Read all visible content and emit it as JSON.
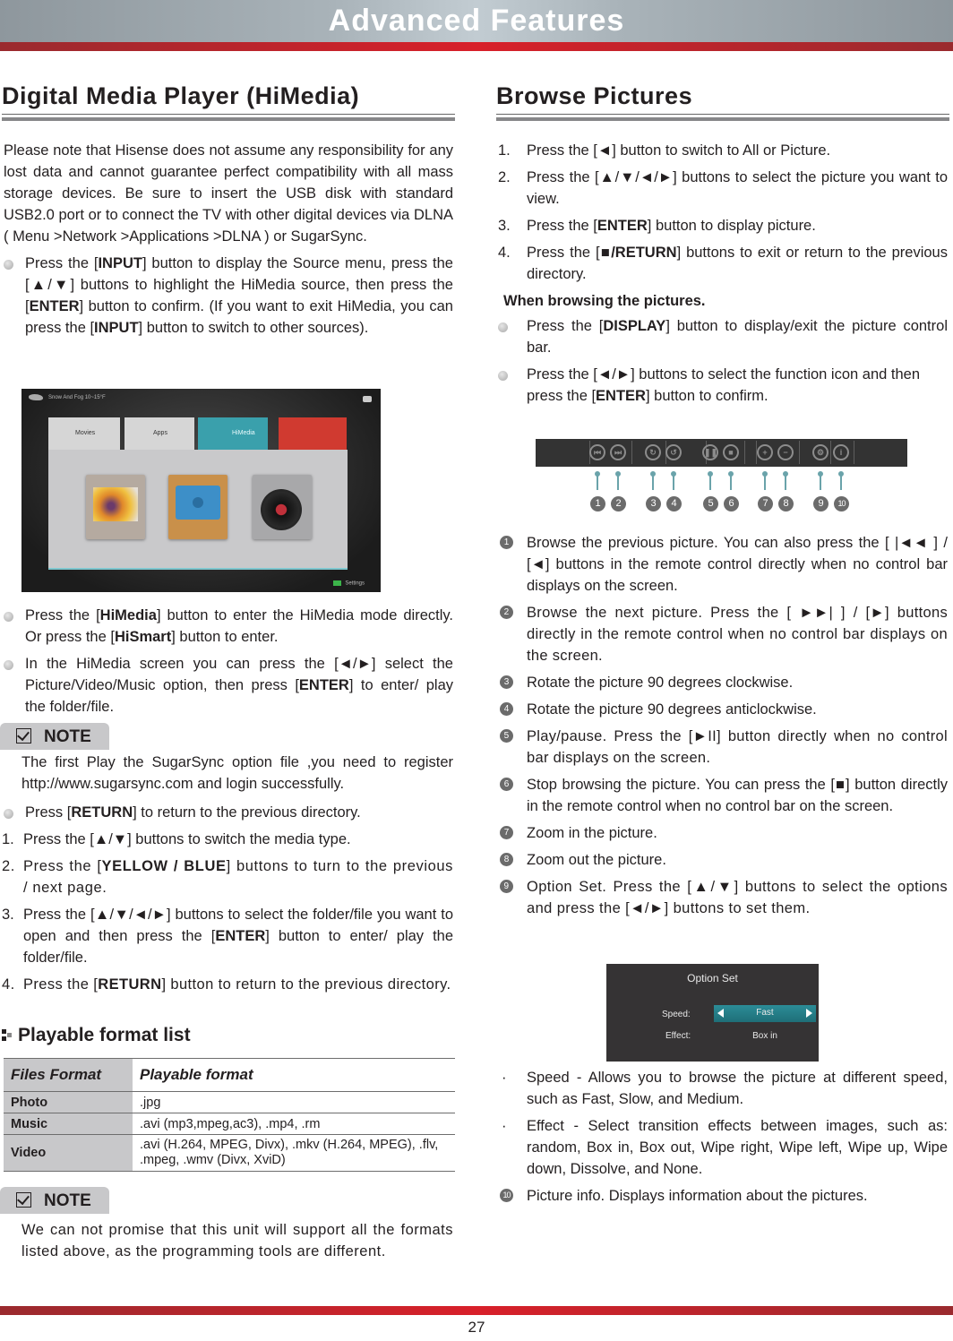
{
  "banner": {
    "title": "Advanced Features"
  },
  "left": {
    "title": "Digital Media Player (HiMedia)",
    "intro": "Please note that Hisense does not assume any responsibility for any lost data and cannot guarantee perfect compatibility with all mass storage devices. Be sure to insert the USB disk with standard USB2.0 port or to connect the TV with other digital devices via DLNA ( Menu >Network >Applications >DLNA ) or SugarSync.",
    "bullet1": {
      "t1": "Press the [",
      "b1": "INPUT",
      "t2": "] button to display the Source menu, press the [▲/▼] buttons to highlight the HiMedia source, then press the [",
      "b2": "ENTER",
      "t3": "] button to confirm. (If you want to exit HiMedia, you can press the [",
      "b3": "INPUT",
      "t4": "] button to switch to other sources)."
    },
    "tv_screen": {
      "top_text": "Snow And Fog  10~15°F",
      "tabs": [
        "Movies",
        "Apps",
        "HiMedia"
      ],
      "cards": [
        "Photo",
        "Video",
        "Music"
      ],
      "settings_label": "Settings"
    },
    "bullet2": {
      "t1": "Press the [",
      "b1": "HiMedia",
      "t2": "] button to enter the HiMedia mode directly. Or press the [",
      "b2": "HiSmart",
      "t3": "] button to enter."
    },
    "bullet3": {
      "t1": "In the HiMedia screen you can press the [◄/►] select the Picture/Video/Music option, then press [",
      "b1": "ENTER",
      "t2": "] to enter/ play the folder/file."
    },
    "note1": {
      "label": "NOTE",
      "text": "The first Play the SugarSync option file ,you need to register http://www.sugarsync.com and login successfully."
    },
    "bullet4": {
      "t1": "Press [",
      "b1": "RETURN",
      "t2": "] to return to the previous directory."
    },
    "steps": [
      {
        "n": "1.",
        "t1": "Press the [▲/▼] buttons to switch the media type.",
        "b1": "",
        "t2": ""
      },
      {
        "n": "2.",
        "t1": "Press the [",
        "b1": "YELLOW / BLUE",
        "t2": "] buttons to turn to the previous / next page."
      },
      {
        "n": "3.",
        "t1": "Press the [▲/▼/◄/►] buttons to select the folder/file you want to open and then press the [",
        "b1": "ENTER",
        "t2": "] button to enter/ play the folder/file."
      },
      {
        "n": "4.",
        "t1": "Press the [",
        "b1": "RETURN",
        "t2": "] button to return to the previous directory."
      }
    ],
    "formats": {
      "title": "Playable format list",
      "headers": [
        "Files Format",
        "Playable format"
      ],
      "rows": [
        {
          "type": "Photo",
          "format": ".jpg"
        },
        {
          "type": "Music",
          "format": ".avi (mp3,mpeg,ac3), .mp4, .rm"
        },
        {
          "type": "Video",
          "format": ".avi (H.264, MPEG, Divx), .mkv (H.264, MPEG), .flv, .mpeg, .wmv (Divx, XviD)"
        }
      ]
    },
    "note2": {
      "label": "NOTE",
      "text": "We can not promise that this unit will support all the formats listed above, as the programming tools are different."
    }
  },
  "right": {
    "title": "Browse Pictures",
    "steps": [
      {
        "n": "1.",
        "t1": "Press the [◄] button to switch to All or Picture.",
        "b1": "",
        "t2": ""
      },
      {
        "n": "2.",
        "t1": "Press the [▲/▼/◄/►] buttons to select the picture you want to view.",
        "b1": "",
        "t2": ""
      },
      {
        "n": "3.",
        "t1": "Press the [",
        "b1": "ENTER",
        "t2": "] button to display picture."
      },
      {
        "n": "4.",
        "t1": "Press the [",
        "b1": "■/RETURN",
        "t2": "] buttons to exit or return to the previous directory."
      }
    ],
    "subhead": "When browsing the pictures.",
    "bullet1": {
      "t1": "Press the [",
      "b1": "DISPLAY",
      "t2": "] button to display/exit the picture control bar."
    },
    "bullet2": {
      "t1": "Press the [◄/►] buttons to select the function icon and then press the [",
      "b1": "ENTER",
      "t2": "] button to confirm."
    },
    "control_bar": {
      "icons": [
        "previous-icon",
        "next-icon",
        "rotate-clockwise-icon",
        "rotate-anticlockwise-icon",
        "pause-icon",
        "stop-icon",
        "zoom-in-icon",
        "zoom-out-icon",
        "settings-icon",
        "info-icon"
      ],
      "glyphs": [
        "⏮",
        "⏭",
        "↻",
        "↺",
        "❚❚",
        "■",
        "+",
        "−",
        "⚙",
        "i"
      ],
      "badges": [
        "1",
        "2",
        "3",
        "4",
        "5",
        "6",
        "7",
        "8",
        "9",
        "10"
      ]
    },
    "items": [
      {
        "c": "1",
        "text": "Browse the previous picture. You can also press the [ |◄◄ ] / [◄] buttons in the remote control directly when no control bar displays on the screen."
      },
      {
        "c": "2",
        "text": "Browse the next picture. Press the [ ►►| ] / [►] buttons directly in the remote control when no control bar displays on the screen."
      },
      {
        "c": "3",
        "text": "Rotate the picture 90 degrees clockwise."
      },
      {
        "c": "4",
        "text": "Rotate the picture 90 degrees anticlockwise."
      },
      {
        "c": "5",
        "text": "Play/pause. Press the [►II] button directly when no control bar displays on the screen."
      },
      {
        "c": "6",
        "text": "Stop browsing the picture. You can press the [■] button directly in the remote control when no control bar on the screen."
      },
      {
        "c": "7",
        "text": "Zoom in the picture."
      },
      {
        "c": "8",
        "text": "Zoom out the picture."
      },
      {
        "c": "9",
        "text": "Option Set. Press the [▲/▼] buttons to select the options and press the [◄/►] buttons to set them."
      }
    ],
    "option_set": {
      "title": "Option Set",
      "speed_label": "Speed:",
      "speed_value": "Fast",
      "effect_label": "Effect:",
      "effect_value": "Box in"
    },
    "details": [
      {
        "d": "·",
        "text": "Speed - Allows you to browse the picture at different speed, such as Fast, Slow, and Medium."
      },
      {
        "d": "·",
        "text": "Effect - Select transition effects between images, such as: random, Box in, Box out, Wipe right, Wipe left, Wipe up, Wipe down, Dissolve, and None."
      }
    ],
    "item10": {
      "c": "10",
      "text": "Picture info. Displays information about the pictures."
    }
  },
  "footer": {
    "page_number": "27"
  }
}
